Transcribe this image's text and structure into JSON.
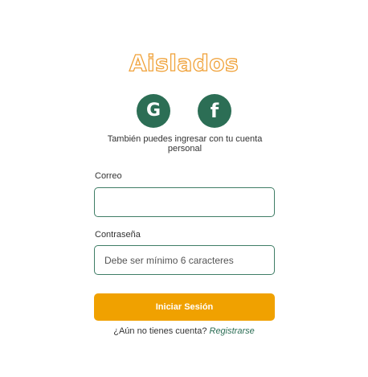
{
  "app": {
    "logo_text": "Aislados"
  },
  "social": {
    "google_glyph": "G",
    "facebook_glyph": "f",
    "google_icon": "google-icon",
    "facebook_icon": "facebook-icon",
    "alt_text": "También puedes ingresar con tu cuenta personal"
  },
  "form": {
    "email_label": "Correo",
    "email_value": "",
    "email_placeholder": "",
    "password_label": "Contraseña",
    "password_value": "",
    "password_placeholder": "Debe ser mínimo 6 caracteres",
    "submit_label": "Iniciar Sesión"
  },
  "footer": {
    "register_prompt": "¿Aún no tienes cuenta?",
    "register_link": "Registrarse"
  },
  "colors": {
    "brand_green": "#2c6e55",
    "accent_orange": "#f0a100",
    "logo_outline": "#f0a23a"
  }
}
